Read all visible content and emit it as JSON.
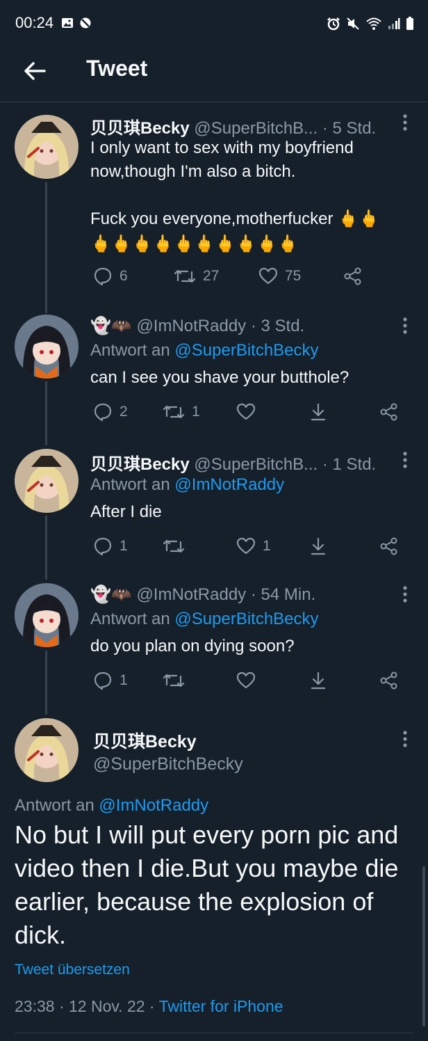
{
  "status_bar": {
    "time": "00:24",
    "icons": [
      "gallery-icon",
      "blocked-icon",
      "alarm-icon",
      "mute-icon",
      "wifi-icon",
      "signal-icon",
      "battery-icon"
    ]
  },
  "header": {
    "title": "Tweet",
    "back_icon": "arrow-left-icon"
  },
  "colors": {
    "background": "#15202b",
    "accent": "#1d9bf0",
    "secondary_text": "#8b98a5",
    "line": "#38444d"
  },
  "tweets": [
    {
      "name": "贝贝琪Becky",
      "handle": "@SuperBitchB...",
      "sep": " · ",
      "time": "5 Std.",
      "text": "I only want to sex with my boyfriend\nnow,though I'm also a bitch.\n\nFuck you everyone,motherfucker 🖕🖕",
      "emoji_line": "🖕🖕🖕🖕🖕🖕🖕🖕🖕🖕",
      "replies": "6",
      "retweets": "27",
      "likes": "75"
    },
    {
      "name": "👻🦇",
      "handle": "@ImNotRaddy",
      "sep": " · ",
      "time": "3 Std.",
      "reply_prefix": "Antwort an ",
      "reply_to": "@SuperBitchBecky",
      "text": "can I see you shave your butthole?",
      "replies": "2",
      "retweets": "1",
      "likes": ""
    },
    {
      "name": "贝贝琪Becky",
      "handle": "@SuperBitchB...",
      "sep": " · ",
      "time": "1 Std.",
      "reply_prefix": "Antwort an ",
      "reply_to": "@ImNotRaddy",
      "text": "After I die",
      "replies": "1",
      "retweets": "",
      "likes": "1"
    },
    {
      "name": "👻🦇",
      "handle": "@ImNotRaddy",
      "sep": " · ",
      "time": "54 Min.",
      "reply_prefix": "Antwort an ",
      "reply_to": "@SuperBitchBecky",
      "text": "do you plan on dying soon?",
      "replies": "1",
      "retweets": "",
      "likes": ""
    }
  ],
  "main_tweet": {
    "name": "贝贝琪Becky",
    "handle": "@SuperBitchBecky",
    "reply_prefix": "Antwort an ",
    "reply_to": "@ImNotRaddy",
    "text": "No but I will put every porn pic and video then I die.But you maybe die earlier, because the explosion of dick.",
    "translate": "Tweet übersetzen",
    "timestamp": "23:38 · 12 Nov. 22 · ",
    "client": "Twitter for iPhone"
  }
}
